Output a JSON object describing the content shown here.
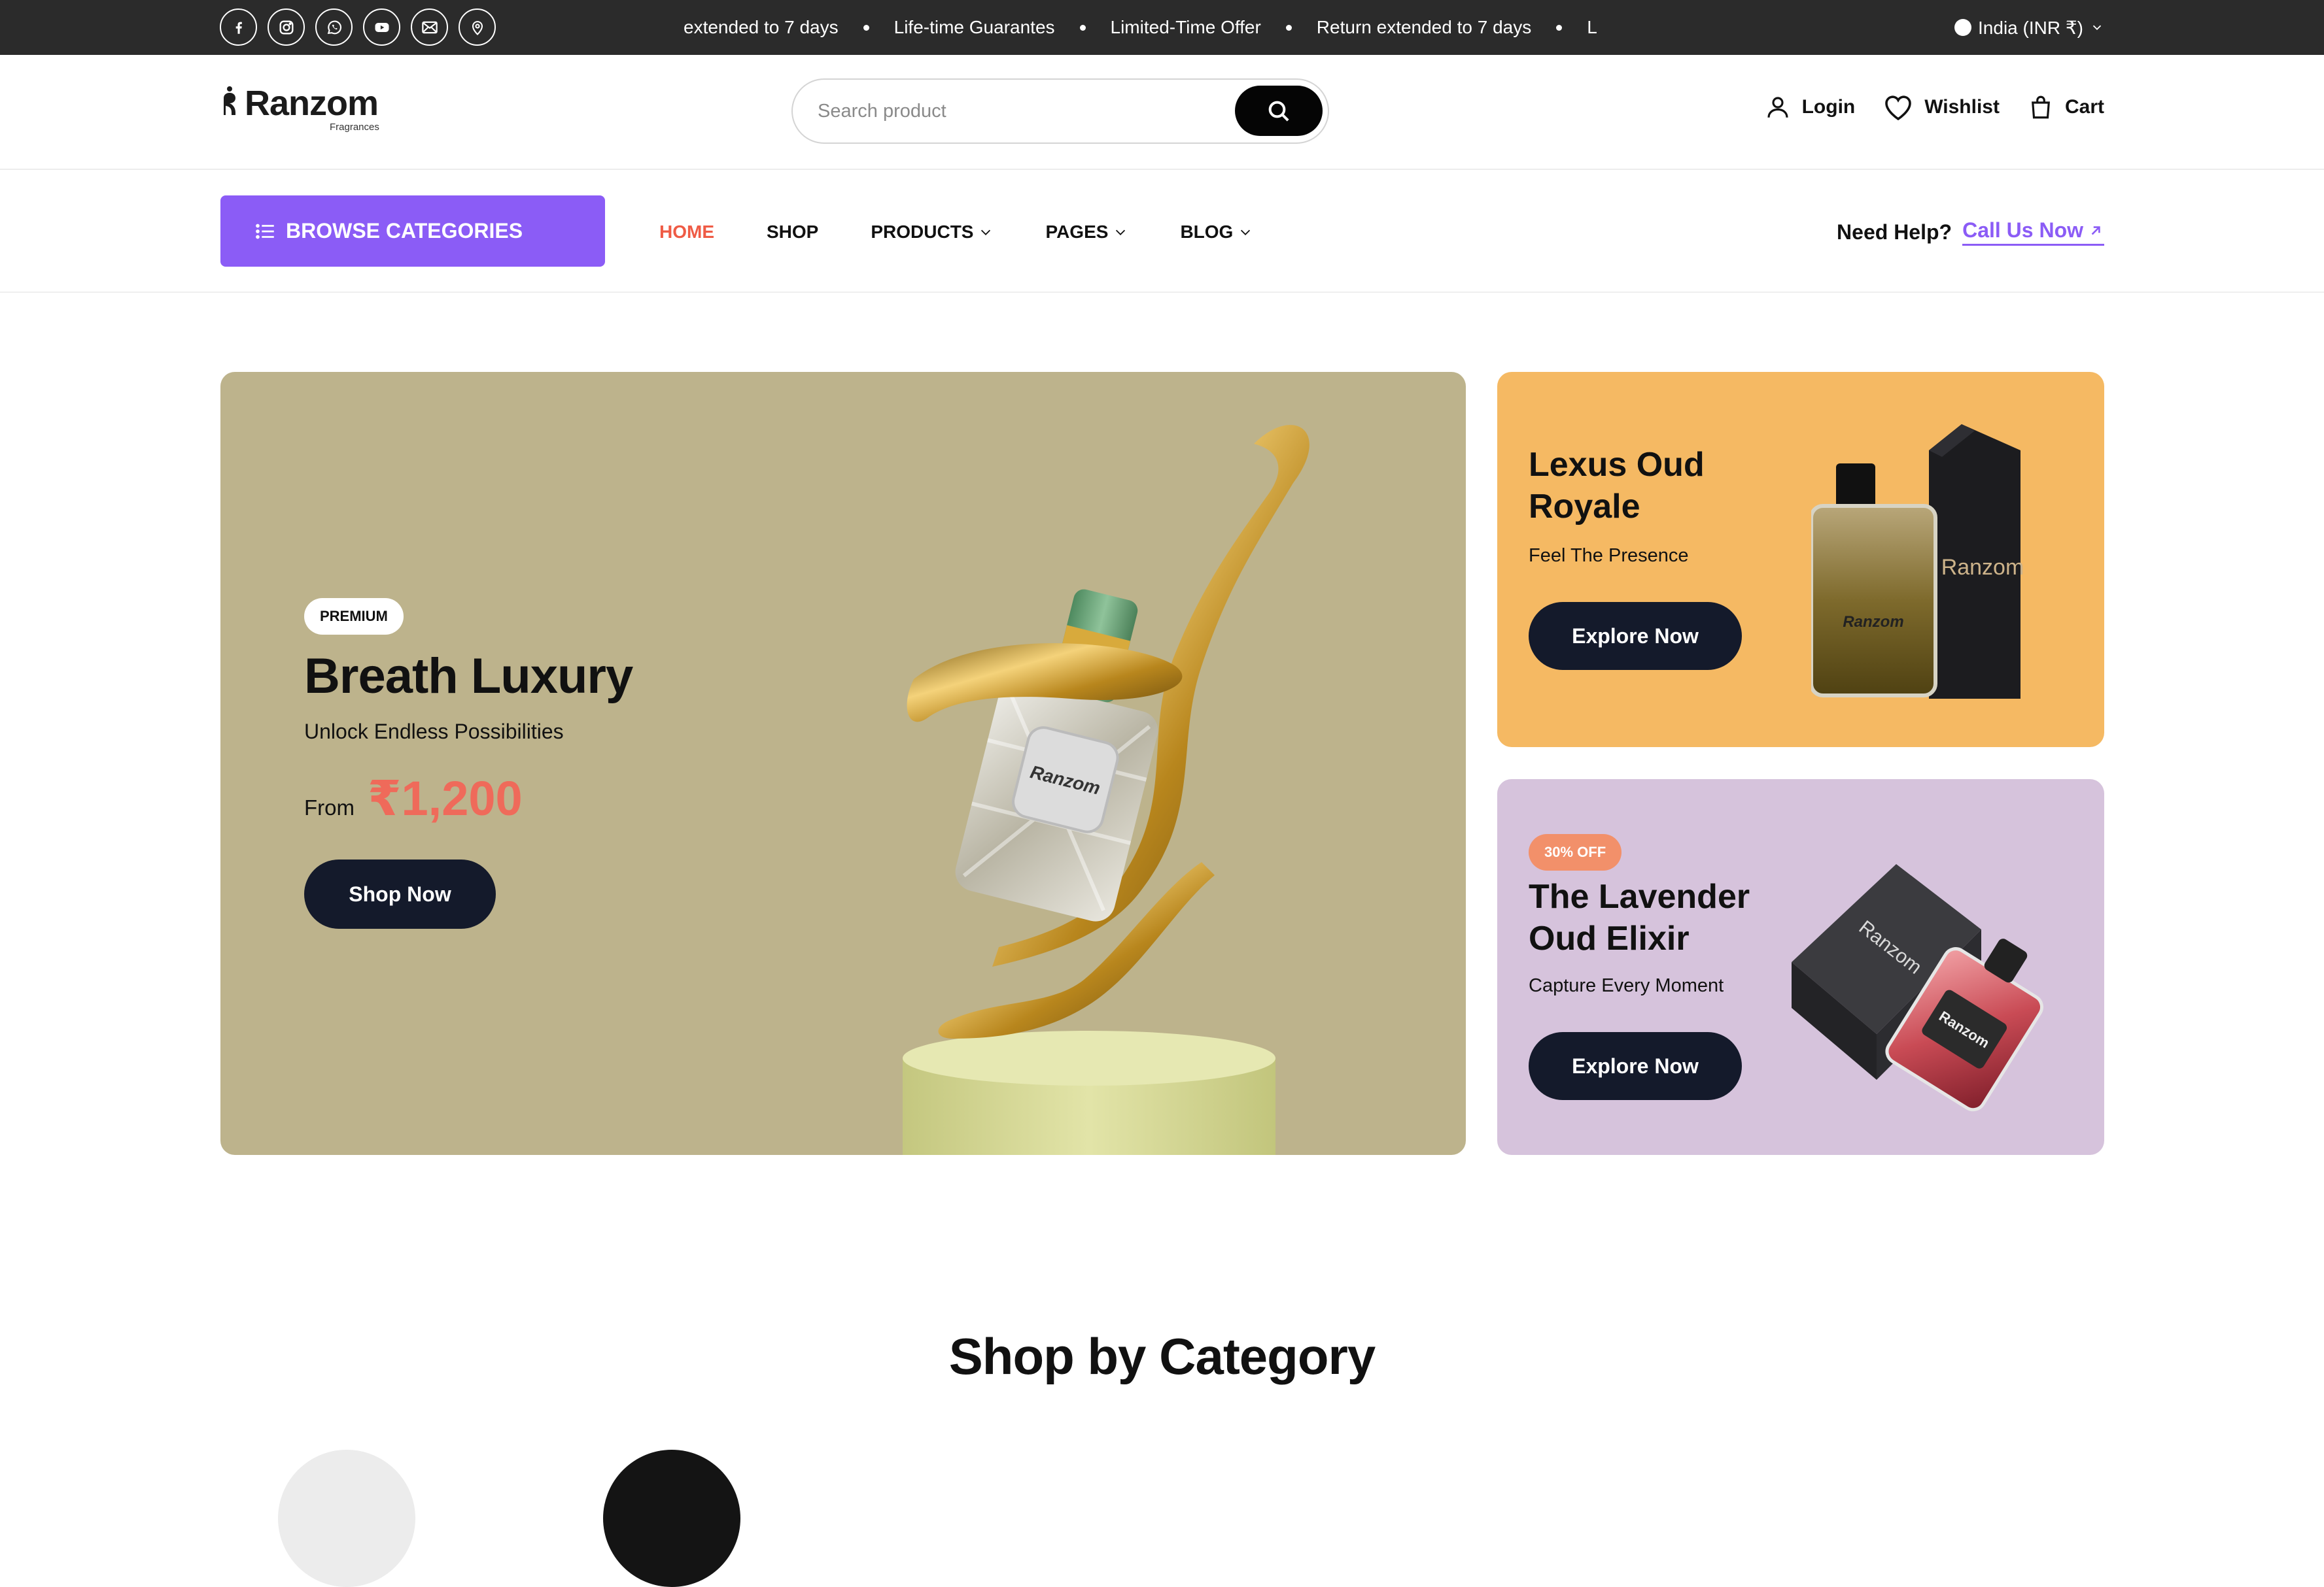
{
  "topbar": {
    "socials": [
      "facebook-icon",
      "instagram-icon",
      "whatsapp-icon",
      "youtube-icon",
      "mail-icon",
      "location-icon"
    ],
    "ticker": [
      "extended to 7 days",
      "Life-time Guarantes",
      "Limited-Time Offer",
      "Return extended to 7 days",
      "L"
    ],
    "locale": "India (INR ₹)"
  },
  "header": {
    "brand": "Ranzom",
    "brand_sub": "Fragrances",
    "search_placeholder": "Search product",
    "login": "Login",
    "wishlist": "Wishlist",
    "cart": "Cart"
  },
  "nav": {
    "browse": "BROWSE CATEGORIES",
    "items": [
      "HOME",
      "SHOP",
      "PRODUCTS",
      "PAGES",
      "BLOG"
    ],
    "help_q": "Need Help?",
    "help_link": "Call Us Now"
  },
  "hero": {
    "badge": "PREMIUM",
    "title": "Breath Luxury",
    "subtitle": "Unlock Endless Possibilities",
    "from": "From",
    "price": "₹1,200",
    "cta": "Shop Now",
    "bottle_label": "Ranzom"
  },
  "promo1": {
    "title_1": "Lexus Oud",
    "title_2": "Royale",
    "subtitle": "Feel The Presence",
    "cta": "Explore Now",
    "box_label": "Ranzom",
    "bottle_label": "Ranzom"
  },
  "promo2": {
    "badge": "30% OFF",
    "title_1": "The Lavender",
    "title_2": "Oud Elixir",
    "subtitle": "Capture Every Moment",
    "cta": "Explore Now",
    "box_label": "Ranzom",
    "bottle_label": "Ranzom"
  },
  "section": {
    "title": "Shop by Category"
  },
  "colors": {
    "accent": "#8b5cf6",
    "price": "#ef6a5a",
    "active_nav": "#ef5b45",
    "button_dark": "#141a2b"
  }
}
